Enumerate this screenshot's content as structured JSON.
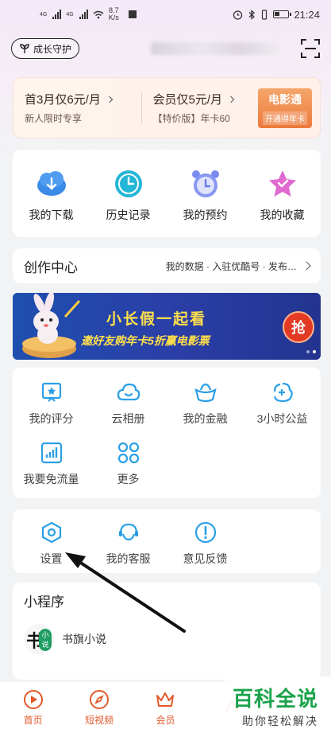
{
  "status_bar": {
    "net1": "4G",
    "net2": "4G",
    "speed": "8.7",
    "speed_unit": "K/s",
    "time": "21:24"
  },
  "header": {
    "guard_label": "成长守护",
    "scan_icon": "scan-icon"
  },
  "vip": {
    "offer1_title": "首3月仅6元/月",
    "offer1_sub": "新人限时专享",
    "offer2_title": "会员仅5元/月",
    "offer2_sub": "【特价版】年卡60",
    "movie_title": "电影通",
    "movie_sub": "开通得年卡"
  },
  "quick_actions": [
    {
      "label": "我的下载",
      "icon": "download-icon",
      "color": "#3b8be8"
    },
    {
      "label": "历史记录",
      "icon": "clock-icon",
      "color": "#23b6d6"
    },
    {
      "label": "我的预约",
      "icon": "alarm-icon",
      "color": "#7a8cf0"
    },
    {
      "label": "我的收藏",
      "icon": "star-icon",
      "color": "#d94fb0"
    }
  ],
  "creator": {
    "title": "创作中心",
    "links": "我的数据 · 入驻优酷号 · 发布…"
  },
  "banner": {
    "title": "小长假一起看",
    "subtitle": "邀好友购年卡5折赢电影票",
    "button": "抢"
  },
  "services": [
    {
      "label": "我的评分",
      "icon": "rating-icon"
    },
    {
      "label": "云相册",
      "icon": "cloud-icon"
    },
    {
      "label": "我的金融",
      "icon": "gold-icon"
    },
    {
      "label": "3小时公益",
      "icon": "charity-icon"
    },
    {
      "label": "我要免流量",
      "icon": "data-plan-icon"
    },
    {
      "label": "更多",
      "icon": "grid-icon"
    }
  ],
  "settings_row": [
    {
      "label": "设置",
      "icon": "settings-icon"
    },
    {
      "label": "我的客服",
      "icon": "headset-icon"
    },
    {
      "label": "意见反馈",
      "icon": "feedback-icon"
    }
  ],
  "mini_programs": {
    "title": "小程序",
    "items": [
      {
        "label": "书旗小说",
        "logo_text": "书",
        "logo_badge": "小说"
      }
    ]
  },
  "tabs": [
    {
      "label": "首页",
      "icon": "home-icon"
    },
    {
      "label": "短视频",
      "icon": "compass-icon"
    },
    {
      "label": "会员",
      "icon": "crown-icon"
    },
    {
      "label": "",
      "icon": "tab4-icon"
    }
  ],
  "watermark": {
    "title": "百科全说",
    "subtitle": "助你轻松解决"
  },
  "colors": {
    "accent": "#2a9fe6",
    "tab_accent": "#e05a2b",
    "banner_bg": "#2b3fa8",
    "banner_text": "#ffe04a"
  }
}
